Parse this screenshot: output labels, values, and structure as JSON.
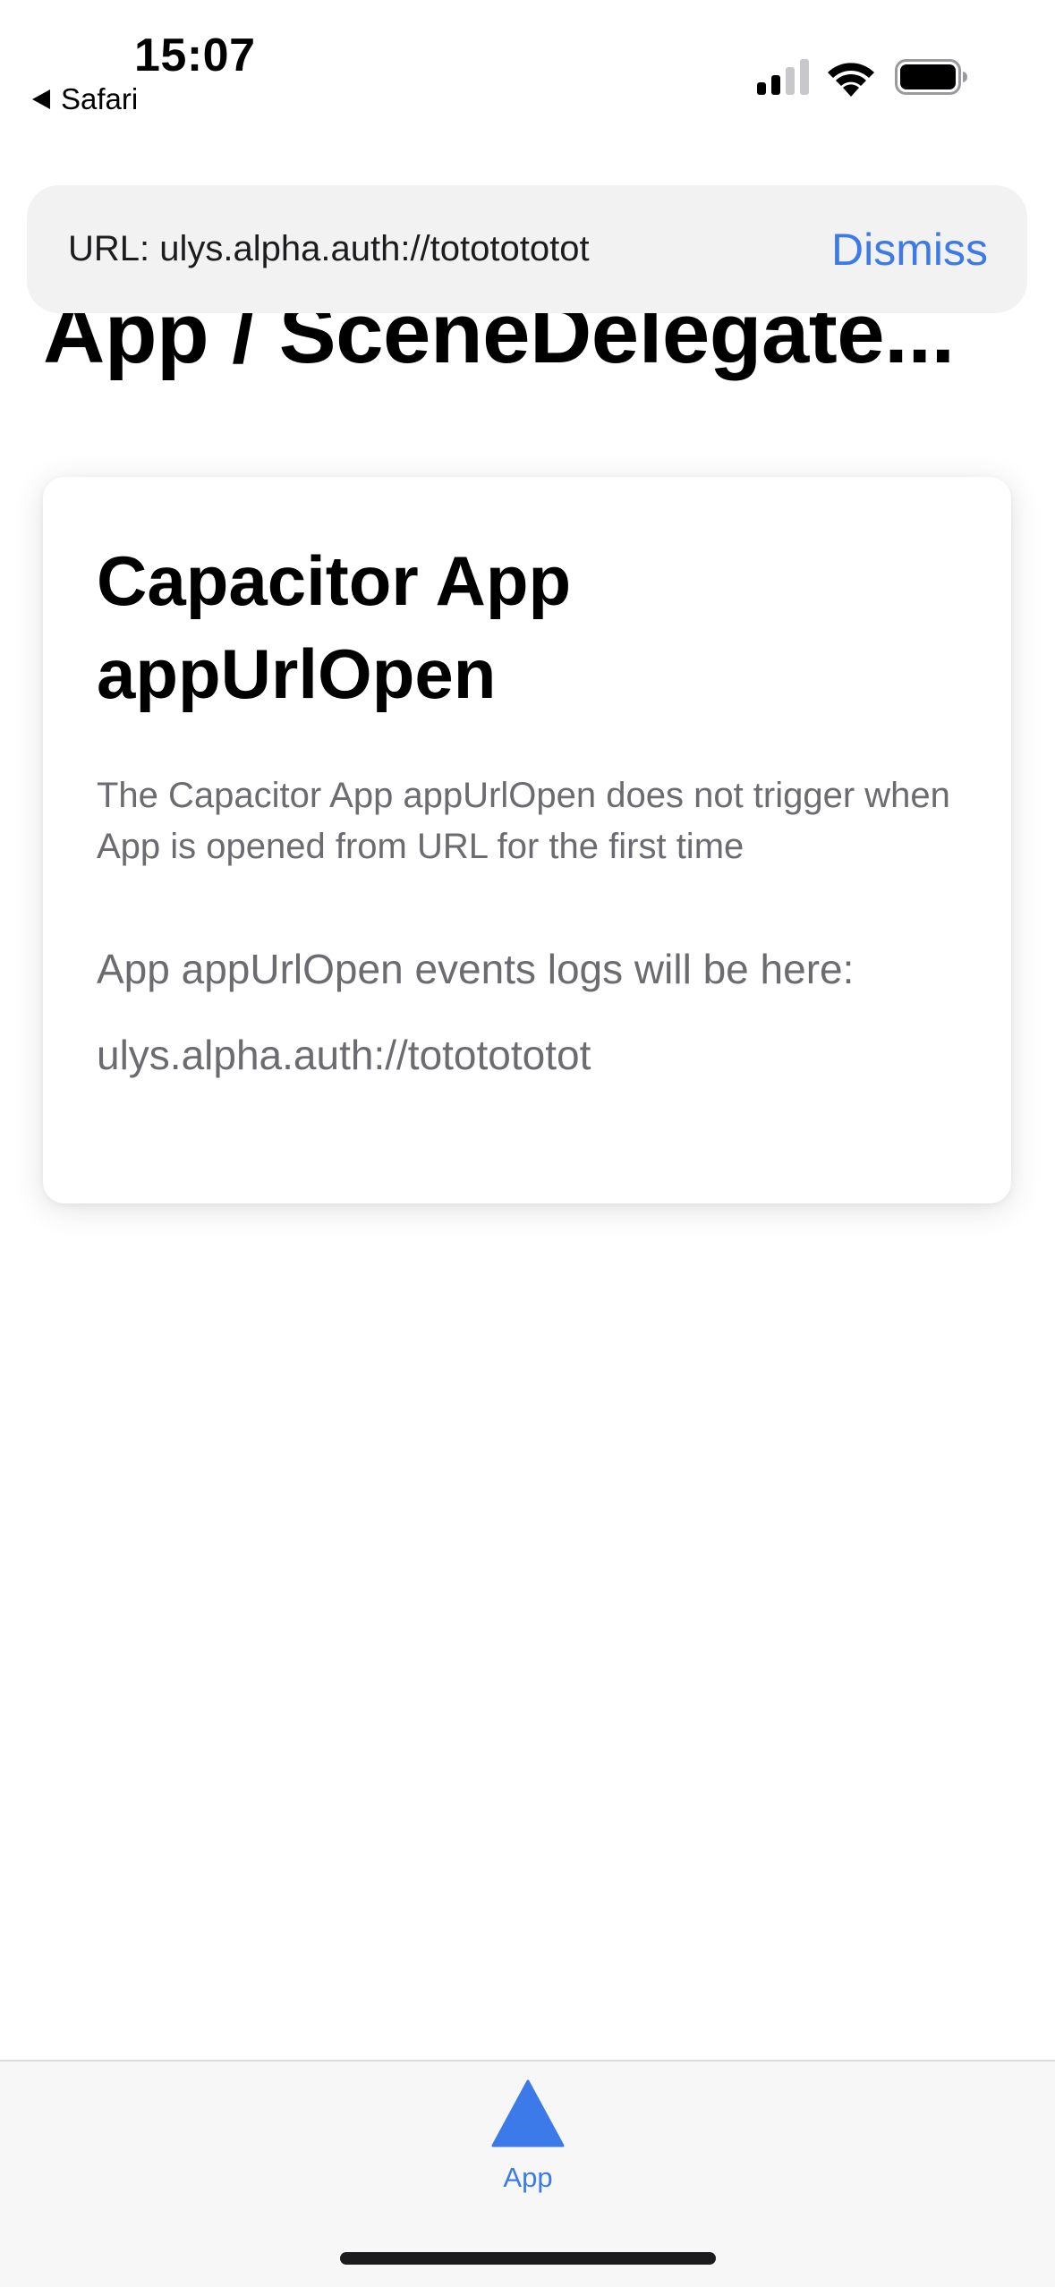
{
  "status_bar": {
    "time": "15:07",
    "back_app": "Safari",
    "icons": [
      "signal-icon",
      "wifi-icon",
      "battery-icon"
    ]
  },
  "banner": {
    "url_text": "URL: ulys.alpha.auth://tototototot",
    "dismiss_label": "Dismiss"
  },
  "page": {
    "title": "App / SceneDelegate..."
  },
  "card": {
    "title": "Capacitor App appUrlOpen",
    "subtitle": "The Capacitor App appUrlOpen does not trigger when App is opened from URL for the first time",
    "log_label": "App appUrlOpen events logs will be here:",
    "log_entries": [
      "ulys.alpha.auth://tototototot"
    ]
  },
  "tab_bar": {
    "tabs": [
      {
        "label": "App",
        "icon": "triangle-icon",
        "selected": true
      }
    ]
  },
  "colors": {
    "accent": "#3b7ae8",
    "banner_bg": "#f2f2f3",
    "secondary_text": "#6b6b70",
    "tab_bar_bg": "#f7f7f7"
  }
}
